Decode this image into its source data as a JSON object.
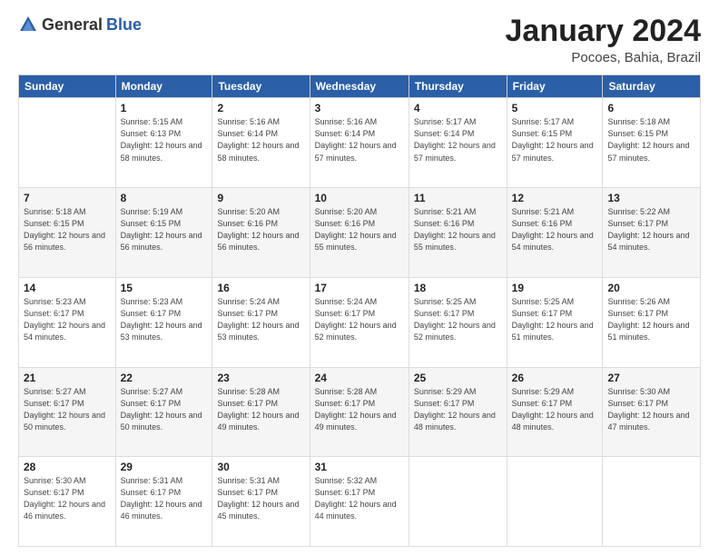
{
  "logo": {
    "general": "General",
    "blue": "Blue"
  },
  "header": {
    "title": "January 2024",
    "subtitle": "Pocoes, Bahia, Brazil"
  },
  "days_of_week": [
    "Sunday",
    "Monday",
    "Tuesday",
    "Wednesday",
    "Thursday",
    "Friday",
    "Saturday"
  ],
  "weeks": [
    [
      {
        "day": "",
        "sunrise": "",
        "sunset": "",
        "daylight": ""
      },
      {
        "day": "1",
        "sunrise": "Sunrise: 5:15 AM",
        "sunset": "Sunset: 6:13 PM",
        "daylight": "Daylight: 12 hours and 58 minutes."
      },
      {
        "day": "2",
        "sunrise": "Sunrise: 5:16 AM",
        "sunset": "Sunset: 6:14 PM",
        "daylight": "Daylight: 12 hours and 58 minutes."
      },
      {
        "day": "3",
        "sunrise": "Sunrise: 5:16 AM",
        "sunset": "Sunset: 6:14 PM",
        "daylight": "Daylight: 12 hours and 57 minutes."
      },
      {
        "day": "4",
        "sunrise": "Sunrise: 5:17 AM",
        "sunset": "Sunset: 6:14 PM",
        "daylight": "Daylight: 12 hours and 57 minutes."
      },
      {
        "day": "5",
        "sunrise": "Sunrise: 5:17 AM",
        "sunset": "Sunset: 6:15 PM",
        "daylight": "Daylight: 12 hours and 57 minutes."
      },
      {
        "day": "6",
        "sunrise": "Sunrise: 5:18 AM",
        "sunset": "Sunset: 6:15 PM",
        "daylight": "Daylight: 12 hours and 57 minutes."
      }
    ],
    [
      {
        "day": "7",
        "sunrise": "Sunrise: 5:18 AM",
        "sunset": "Sunset: 6:15 PM",
        "daylight": "Daylight: 12 hours and 56 minutes."
      },
      {
        "day": "8",
        "sunrise": "Sunrise: 5:19 AM",
        "sunset": "Sunset: 6:15 PM",
        "daylight": "Daylight: 12 hours and 56 minutes."
      },
      {
        "day": "9",
        "sunrise": "Sunrise: 5:20 AM",
        "sunset": "Sunset: 6:16 PM",
        "daylight": "Daylight: 12 hours and 56 minutes."
      },
      {
        "day": "10",
        "sunrise": "Sunrise: 5:20 AM",
        "sunset": "Sunset: 6:16 PM",
        "daylight": "Daylight: 12 hours and 55 minutes."
      },
      {
        "day": "11",
        "sunrise": "Sunrise: 5:21 AM",
        "sunset": "Sunset: 6:16 PM",
        "daylight": "Daylight: 12 hours and 55 minutes."
      },
      {
        "day": "12",
        "sunrise": "Sunrise: 5:21 AM",
        "sunset": "Sunset: 6:16 PM",
        "daylight": "Daylight: 12 hours and 54 minutes."
      },
      {
        "day": "13",
        "sunrise": "Sunrise: 5:22 AM",
        "sunset": "Sunset: 6:17 PM",
        "daylight": "Daylight: 12 hours and 54 minutes."
      }
    ],
    [
      {
        "day": "14",
        "sunrise": "Sunrise: 5:23 AM",
        "sunset": "Sunset: 6:17 PM",
        "daylight": "Daylight: 12 hours and 54 minutes."
      },
      {
        "day": "15",
        "sunrise": "Sunrise: 5:23 AM",
        "sunset": "Sunset: 6:17 PM",
        "daylight": "Daylight: 12 hours and 53 minutes."
      },
      {
        "day": "16",
        "sunrise": "Sunrise: 5:24 AM",
        "sunset": "Sunset: 6:17 PM",
        "daylight": "Daylight: 12 hours and 53 minutes."
      },
      {
        "day": "17",
        "sunrise": "Sunrise: 5:24 AM",
        "sunset": "Sunset: 6:17 PM",
        "daylight": "Daylight: 12 hours and 52 minutes."
      },
      {
        "day": "18",
        "sunrise": "Sunrise: 5:25 AM",
        "sunset": "Sunset: 6:17 PM",
        "daylight": "Daylight: 12 hours and 52 minutes."
      },
      {
        "day": "19",
        "sunrise": "Sunrise: 5:25 AM",
        "sunset": "Sunset: 6:17 PM",
        "daylight": "Daylight: 12 hours and 51 minutes."
      },
      {
        "day": "20",
        "sunrise": "Sunrise: 5:26 AM",
        "sunset": "Sunset: 6:17 PM",
        "daylight": "Daylight: 12 hours and 51 minutes."
      }
    ],
    [
      {
        "day": "21",
        "sunrise": "Sunrise: 5:27 AM",
        "sunset": "Sunset: 6:17 PM",
        "daylight": "Daylight: 12 hours and 50 minutes."
      },
      {
        "day": "22",
        "sunrise": "Sunrise: 5:27 AM",
        "sunset": "Sunset: 6:17 PM",
        "daylight": "Daylight: 12 hours and 50 minutes."
      },
      {
        "day": "23",
        "sunrise": "Sunrise: 5:28 AM",
        "sunset": "Sunset: 6:17 PM",
        "daylight": "Daylight: 12 hours and 49 minutes."
      },
      {
        "day": "24",
        "sunrise": "Sunrise: 5:28 AM",
        "sunset": "Sunset: 6:17 PM",
        "daylight": "Daylight: 12 hours and 49 minutes."
      },
      {
        "day": "25",
        "sunrise": "Sunrise: 5:29 AM",
        "sunset": "Sunset: 6:17 PM",
        "daylight": "Daylight: 12 hours and 48 minutes."
      },
      {
        "day": "26",
        "sunrise": "Sunrise: 5:29 AM",
        "sunset": "Sunset: 6:17 PM",
        "daylight": "Daylight: 12 hours and 48 minutes."
      },
      {
        "day": "27",
        "sunrise": "Sunrise: 5:30 AM",
        "sunset": "Sunset: 6:17 PM",
        "daylight": "Daylight: 12 hours and 47 minutes."
      }
    ],
    [
      {
        "day": "28",
        "sunrise": "Sunrise: 5:30 AM",
        "sunset": "Sunset: 6:17 PM",
        "daylight": "Daylight: 12 hours and 46 minutes."
      },
      {
        "day": "29",
        "sunrise": "Sunrise: 5:31 AM",
        "sunset": "Sunset: 6:17 PM",
        "daylight": "Daylight: 12 hours and 46 minutes."
      },
      {
        "day": "30",
        "sunrise": "Sunrise: 5:31 AM",
        "sunset": "Sunset: 6:17 PM",
        "daylight": "Daylight: 12 hours and 45 minutes."
      },
      {
        "day": "31",
        "sunrise": "Sunrise: 5:32 AM",
        "sunset": "Sunset: 6:17 PM",
        "daylight": "Daylight: 12 hours and 44 minutes."
      },
      {
        "day": "",
        "sunrise": "",
        "sunset": "",
        "daylight": ""
      },
      {
        "day": "",
        "sunrise": "",
        "sunset": "",
        "daylight": ""
      },
      {
        "day": "",
        "sunrise": "",
        "sunset": "",
        "daylight": ""
      }
    ]
  ]
}
